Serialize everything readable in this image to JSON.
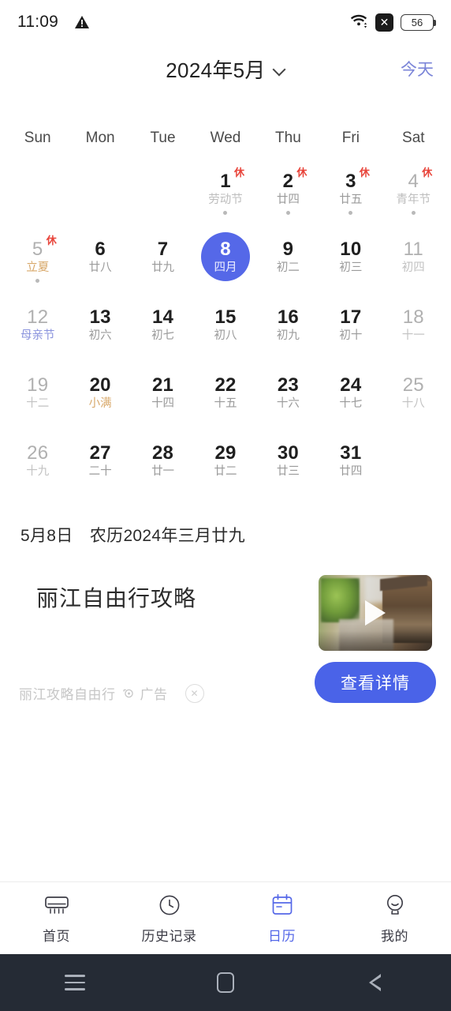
{
  "status_bar": {
    "time": "11:09",
    "warning_icon": "warning-triangle-icon",
    "wifi_icon": "wifi-icon",
    "signal_blocked_icon": "x-icon",
    "signal_blocked_glyph": "✕",
    "battery_level": "56"
  },
  "header": {
    "title": "2024年5月",
    "dropdown_icon": "chevron-down-icon",
    "today_label": "今天"
  },
  "calendar": {
    "weekdays": [
      "Sun",
      "Mon",
      "Tue",
      "Wed",
      "Thu",
      "Fri",
      "Sat"
    ],
    "rest_badge": "休",
    "days": [
      {
        "num": "",
        "lunar": "",
        "empty": true
      },
      {
        "num": "",
        "lunar": "",
        "empty": true
      },
      {
        "num": "",
        "lunar": "",
        "empty": true
      },
      {
        "num": "1",
        "lunar": "劳动节",
        "lunar_style": "fest-gray",
        "badge": "休",
        "dot": true,
        "dim": false
      },
      {
        "num": "2",
        "lunar": "廿四",
        "badge": "休",
        "dot": true,
        "dim": false
      },
      {
        "num": "3",
        "lunar": "廿五",
        "badge": "休",
        "dot": true,
        "dim": false
      },
      {
        "num": "4",
        "lunar": "青年节",
        "lunar_style": "fest-gray",
        "badge": "休",
        "dot": true,
        "dim": true
      },
      {
        "num": "5",
        "lunar": "立夏",
        "lunar_style": "term",
        "badge": "休",
        "dot": true,
        "dim": true
      },
      {
        "num": "6",
        "lunar": "廿八",
        "dim": false
      },
      {
        "num": "7",
        "lunar": "廿九",
        "dim": false
      },
      {
        "num": "8",
        "lunar": "四月",
        "selected": true,
        "dim": false
      },
      {
        "num": "9",
        "lunar": "初二",
        "dim": false
      },
      {
        "num": "10",
        "lunar": "初三",
        "dim": false
      },
      {
        "num": "11",
        "lunar": "初四",
        "lunar_style": "dim",
        "dim": true
      },
      {
        "num": "12",
        "lunar": "母亲节",
        "lunar_style": "fest-blue",
        "dim": true
      },
      {
        "num": "13",
        "lunar": "初六",
        "dim": false
      },
      {
        "num": "14",
        "lunar": "初七",
        "dim": false
      },
      {
        "num": "15",
        "lunar": "初八",
        "dim": false
      },
      {
        "num": "16",
        "lunar": "初九",
        "dim": false
      },
      {
        "num": "17",
        "lunar": "初十",
        "dim": false
      },
      {
        "num": "18",
        "lunar": "十一",
        "lunar_style": "dim",
        "dim": true
      },
      {
        "num": "19",
        "lunar": "十二",
        "lunar_style": "dim",
        "dim": true
      },
      {
        "num": "20",
        "lunar": "小满",
        "lunar_style": "term",
        "dim": false
      },
      {
        "num": "21",
        "lunar": "十四",
        "dim": false
      },
      {
        "num": "22",
        "lunar": "十五",
        "dim": false
      },
      {
        "num": "23",
        "lunar": "十六",
        "dim": false
      },
      {
        "num": "24",
        "lunar": "十七",
        "dim": false
      },
      {
        "num": "25",
        "lunar": "十八",
        "lunar_style": "dim",
        "dim": true
      },
      {
        "num": "26",
        "lunar": "十九",
        "lunar_style": "dim",
        "dim": true
      },
      {
        "num": "27",
        "lunar": "二十",
        "dim": false
      },
      {
        "num": "28",
        "lunar": "廿一",
        "dim": false
      },
      {
        "num": "29",
        "lunar": "廿二",
        "dim": false
      },
      {
        "num": "30",
        "lunar": "廿三",
        "dim": false
      },
      {
        "num": "31",
        "lunar": "廿四",
        "dim": false
      },
      {
        "num": "",
        "lunar": "",
        "empty": true
      }
    ]
  },
  "date_line": "5月8日　农历2024年三月廿九",
  "ad": {
    "title": "丽江自由行攻略",
    "source": "丽江攻略自由行",
    "ad_info_icon": "ad-info-icon",
    "ad_label": "广告",
    "close_icon": "close-icon",
    "close_glyph": "✕",
    "play_icon": "play-icon",
    "cta_label": "查看详情"
  },
  "tabbar": {
    "items": [
      {
        "label": "首页",
        "icon": "air-conditioner-icon",
        "active": false
      },
      {
        "label": "历史记录",
        "icon": "clock-icon",
        "active": false
      },
      {
        "label": "日历",
        "icon": "calendar-icon",
        "active": true
      },
      {
        "label": "我的",
        "icon": "person-icon",
        "active": false
      }
    ]
  },
  "android_nav": {
    "recents_icon": "menu-icon",
    "home_icon": "home-square-icon",
    "back_icon": "back-triangle-icon"
  },
  "colors": {
    "accent": "#5568e8",
    "today_link": "#7b85d8",
    "rest_badge": "#e8443a",
    "solar_term": "#d8a86a",
    "festival_blue": "#8a93dd",
    "cta": "#4a63e8",
    "nav_bar": "#252b35"
  }
}
